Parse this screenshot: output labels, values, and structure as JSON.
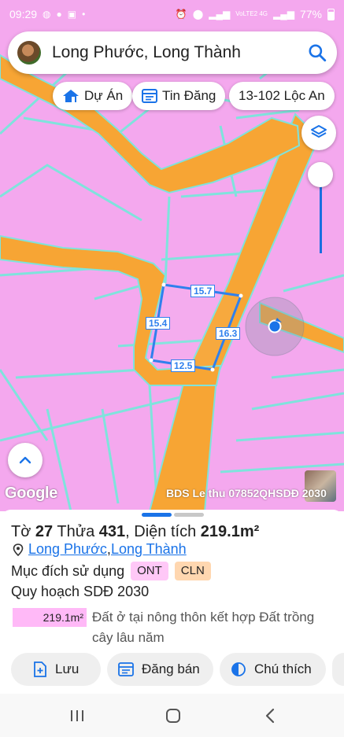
{
  "status_bar": {
    "time": "09:29",
    "network": "VoLTE2 4G",
    "battery": "77%"
  },
  "search": {
    "value": "Long Phước, Long Thành"
  },
  "chips": {
    "du_an": "Dự Án",
    "tin_dang": "Tin Đăng",
    "location": "13-102 Lộc An"
  },
  "map": {
    "parcel_edges": {
      "top": "15.7",
      "left": "15.4",
      "right": "16.3",
      "bottom": "12.5"
    },
    "google_logo": "Google",
    "watermark": "BDS Le thu 07852",
    "plan_label": "QHSDĐ 2030",
    "colors": {
      "land_pink": "#f4a8ee",
      "road_orange": "#f7a534",
      "boundary_cyan": "#7fe3dc",
      "parcel_blue": "#2f80ed"
    }
  },
  "sheet": {
    "to_label": "Tờ",
    "to_value": "27",
    "thua_label": "Thửa",
    "thua_value": "431",
    "dien_tich_label": "Diện tích",
    "dien_tich_value": "219.1m²",
    "location": {
      "ward": "Long Phước",
      "district": "Long Thành"
    },
    "purpose_label": "Mục đích sử dụng",
    "purpose_codes": [
      "ONT",
      "CLN"
    ],
    "plan_label": "Quy hoạch SDĐ 2030",
    "area_value": "219.1m²",
    "area_desc": "Đất ở tại nông thôn kết hợp Đất trồng cây lâu năm",
    "actions": {
      "save": "Lưu",
      "post": "Đăng bán",
      "legend": "Chú thích"
    }
  }
}
